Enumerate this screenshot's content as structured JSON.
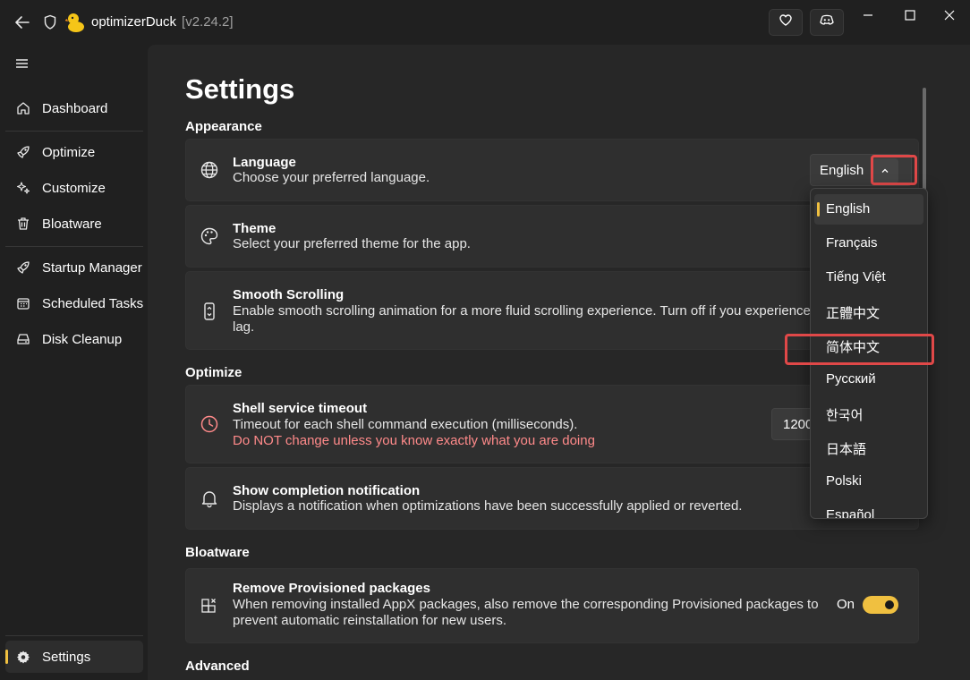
{
  "app": {
    "title": "optimizerDuck",
    "version": "[v2.24.2]"
  },
  "colors": {
    "accent": "#f0c040",
    "warning": "#ff8a8a",
    "highlight": "#e04848"
  },
  "sidebar": {
    "items": [
      {
        "label": "Dashboard",
        "icon": "home-icon"
      },
      {
        "label": "Optimize",
        "icon": "rocket-icon"
      },
      {
        "label": "Customize",
        "icon": "sparkle-icon"
      },
      {
        "label": "Bloatware",
        "icon": "trash-icon"
      },
      {
        "label": "Startup Manager",
        "icon": "rocket-icon"
      },
      {
        "label": "Scheduled Tasks",
        "icon": "calendar-icon"
      },
      {
        "label": "Disk Cleanup",
        "icon": "disk-icon"
      }
    ],
    "settings_label": "Settings"
  },
  "main": {
    "title": "Settings",
    "sections": {
      "appearance": "Appearance",
      "optimize": "Optimize",
      "bloatware": "Bloatware",
      "advanced": "Advanced"
    },
    "language": {
      "title": "Language",
      "desc": "Choose your preferred language.",
      "value": "English"
    },
    "theme": {
      "title": "Theme",
      "desc": "Select your preferred theme for the app."
    },
    "smooth": {
      "title": "Smooth Scrolling",
      "desc": "Enable smooth scrolling animation for a more fluid scrolling experience. Turn off if you experience lag."
    },
    "shell": {
      "title": "Shell service timeout",
      "desc": "Timeout for each shell command execution (milliseconds).",
      "warning": "Do NOT change unless you know exactly what you are doing",
      "value": "1200"
    },
    "notify": {
      "title": "Show completion notification",
      "desc": "Displays a notification when optimizations have been successfully applied or reverted."
    },
    "provisioned": {
      "title": "Remove Provisioned packages",
      "desc": "When removing installed AppX packages, also remove the corresponding Provisioned packages to prevent automatic reinstallation for new users.",
      "toggle_label": "On"
    }
  },
  "dropdown": {
    "options": [
      "English",
      "Français",
      "Tiếng Việt",
      "正體中文",
      "简体中文",
      "Русский",
      "한국어",
      "日本語",
      "Polski",
      "Español"
    ],
    "selected": "English"
  }
}
